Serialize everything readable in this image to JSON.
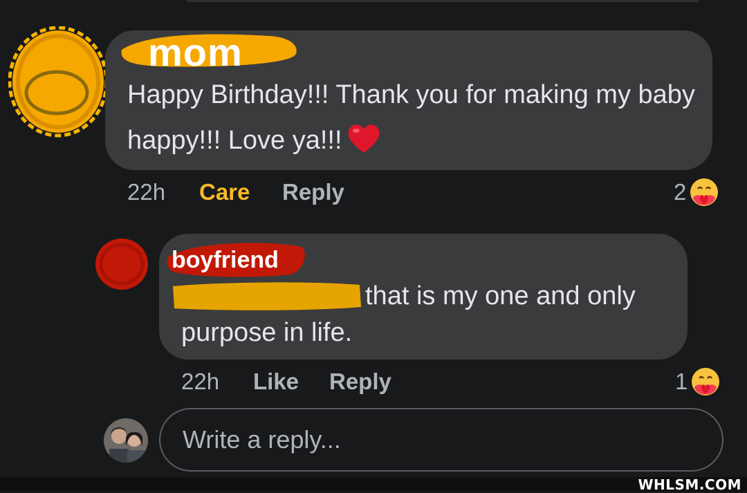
{
  "comment1": {
    "author": "mom",
    "text": "Happy Birthday!!! Thank you for making my baby happy!!! Love ya!!!",
    "time": "22h",
    "reaction_label": "Care",
    "reply_label": "Reply",
    "reaction_count": "2",
    "reaction_icon": "care-emoji-icon",
    "colors": {
      "scribble": "#f5a800",
      "reaction_active": "#f7b928"
    }
  },
  "comment2": {
    "author": "boyfriend",
    "text_line1": "that is my one and only",
    "text_line2": "purpose in life.",
    "time": "22h",
    "like_label": "Like",
    "reply_label": "Reply",
    "reaction_count": "1",
    "reaction_icon": "care-emoji-icon",
    "colors": {
      "scribble": "#c21807",
      "mention_scribble": "#e6a400"
    }
  },
  "reply_input": {
    "placeholder": "Write a reply..."
  },
  "watermark": "WHLSM.COM",
  "colors": {
    "background": "#18191a",
    "bubble": "#3a3b3c",
    "text": "#e4e6eb",
    "secondary_text": "#b0b3b8"
  }
}
